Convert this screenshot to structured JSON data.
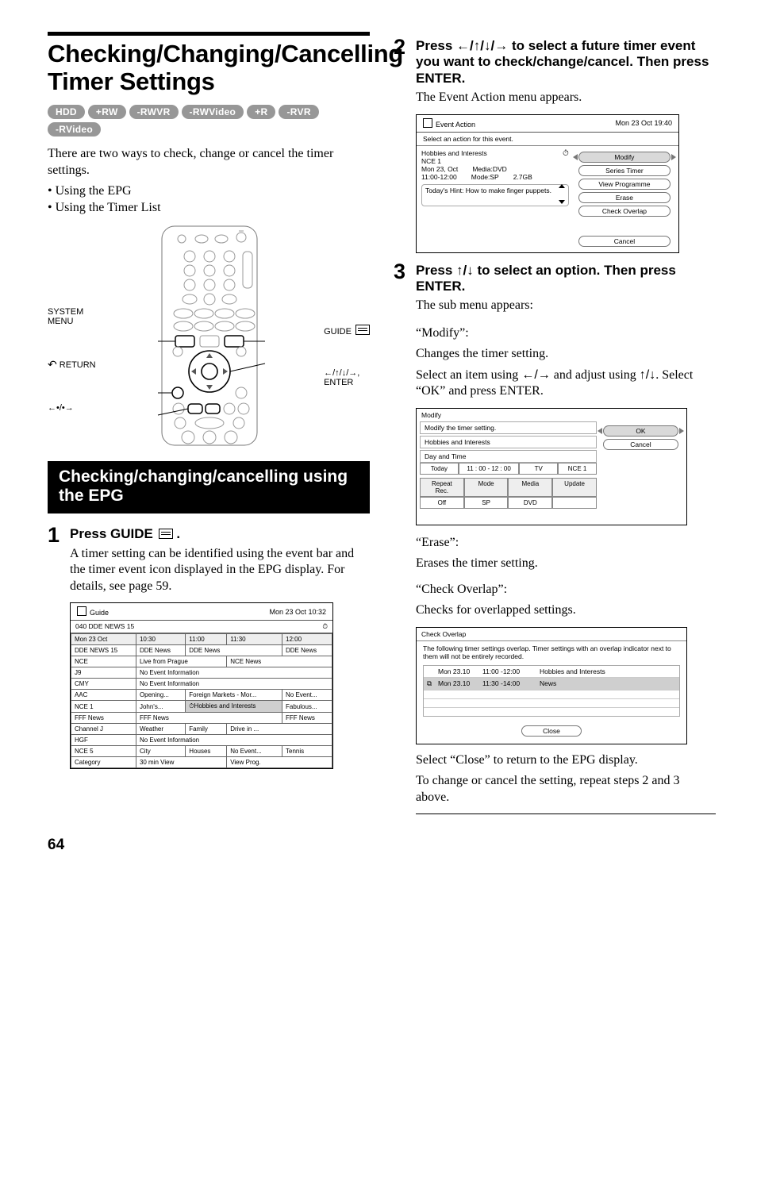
{
  "main_title": "Checking/Changing/Cancelling Timer Settings",
  "badges": [
    "HDD",
    "+RW",
    "-RWVR",
    "-RWVideo",
    "+R",
    "-RVR",
    "-RVideo"
  ],
  "intro": "There are two ways to check, change or cancel the timer settings.",
  "bullets": [
    "Using the EPG",
    "Using the Timer List"
  ],
  "remote_labels": {
    "system_menu_1": "SYSTEM",
    "system_menu_2": "MENU",
    "return": "RETURN",
    "dotnav": "←•/•→",
    "guide": "GUIDE",
    "arrows_enter": "←/↑/↓/→, ENTER"
  },
  "section_heading": "Checking/changing/cancelling using the EPG",
  "step1": {
    "head": "Press GUIDE",
    "head_suffix": ".",
    "text": "A timer setting can be identified using the event bar and the timer event icon displayed in the EPG display. For details, see page 59."
  },
  "guide_ui": {
    "title": "Guide",
    "clock": "Mon 23 Oct   10:32",
    "channel_header": "040     DDE NEWS 15",
    "cols": [
      "Mon 23 Oct",
      "10:30",
      "11:00",
      "11:30",
      "12:00"
    ],
    "rows": [
      {
        "ch": "DDE NEWS 15",
        "cells": [
          "DDE News",
          "DDE News",
          "",
          "DDE News"
        ]
      },
      {
        "ch": "NCE",
        "cells": [
          "Live from Prague",
          "",
          "NCE News",
          ""
        ]
      },
      {
        "ch": "J9",
        "cells": [
          "No Event Information",
          "",
          "",
          ""
        ]
      },
      {
        "ch": "CMY",
        "cells": [
          "No Event Information",
          "",
          "",
          ""
        ]
      },
      {
        "ch": "AAC",
        "cells": [
          "Opening...",
          "Foreign Markets - Mor...",
          "",
          "No Event..."
        ]
      },
      {
        "ch": "NCE 1",
        "cells": [
          "John's...",
          "⏱Hobbies and Interests",
          "",
          "Fabulous..."
        ],
        "hl": 1
      },
      {
        "ch": "FFF News",
        "cells": [
          "FFF News",
          "",
          "",
          "FFF News"
        ]
      },
      {
        "ch": "Channel J",
        "cells": [
          "Weather",
          "Family",
          "Drive in ...",
          ""
        ]
      },
      {
        "ch": "HGF",
        "cells": [
          "No Event Information",
          "",
          "",
          ""
        ]
      },
      {
        "ch": "NCE 5",
        "cells": [
          "City",
          "Houses",
          "No Event...",
          "Tennis"
        ]
      }
    ],
    "footer": [
      "Category",
      "30 min View",
      "View Prog."
    ]
  },
  "step2": {
    "head": "Press ←/↑/↓/→ to select a future timer event you want to check/change/cancel. Then press ENTER.",
    "text": "The Event Action menu appears."
  },
  "event_action": {
    "title": "Event Action",
    "clock": "Mon 23 Oct   19:40",
    "subtitle": "Select an action for this event.",
    "info_line1": "Hobbies and Interests",
    "info_line2": "NCE 1",
    "info_line3a": "Mon 23, Oct",
    "info_line3b": "Media:DVD",
    "info_line4a": "11:00-12:00",
    "info_line4b": "Mode:SP",
    "info_line4c": "2.7GB",
    "hint": "Today's Hint: How to make finger puppets.",
    "buttons": [
      "Modify",
      "Series Timer",
      "View Programme",
      "Erase",
      "Check Overlap"
    ],
    "cancel": "Cancel"
  },
  "step3": {
    "head": "Press ↑/↓ to select an option. Then press ENTER.",
    "text": "The sub menu appears:"
  },
  "modify": {
    "label": "“Modify”:",
    "desc": "Changes the timer setting.",
    "desc2a": "Select an item using ",
    "desc2_arrows": "←/→",
    "desc2b": " and adjust using ",
    "desc2_arrows2": "↑/↓",
    "desc2c": ". Select “OK” and press ENTER.",
    "ui": {
      "title": "Modify",
      "sub1": "Modify the timer setting.",
      "sub2": "Hobbies and Interests",
      "sub3": "Day and Time",
      "row1": [
        "Today",
        "11 : 00  -  12 : 00",
        "TV",
        "NCE 1"
      ],
      "hdr": [
        "Repeat Rec.",
        "Mode",
        "Media",
        "Update"
      ],
      "row2": [
        "Off",
        "SP",
        "DVD",
        ""
      ],
      "ok": "OK",
      "cancel": "Cancel"
    }
  },
  "erase": {
    "label": "“Erase”:",
    "desc": "Erases the timer setting."
  },
  "overlap": {
    "label": "“Check Overlap”:",
    "desc": "Checks for overlapped settings.",
    "ui": {
      "title": "Check Overlap",
      "msg": "The following timer settings overlap. Timer settings with an overlap indicator next to them will not be entirely recorded.",
      "rows": [
        [
          "",
          "Mon 23.10",
          "11:00 -12:00",
          "Hobbies and Interests"
        ],
        [
          "⧉",
          "Mon 23.10",
          "11:30 -14:00",
          "News"
        ]
      ],
      "close": "Close"
    },
    "after1": "Select “Close” to return to the EPG display.",
    "after2": "To change or cancel the setting, repeat steps 2 and 3 above."
  },
  "page_number": "64"
}
